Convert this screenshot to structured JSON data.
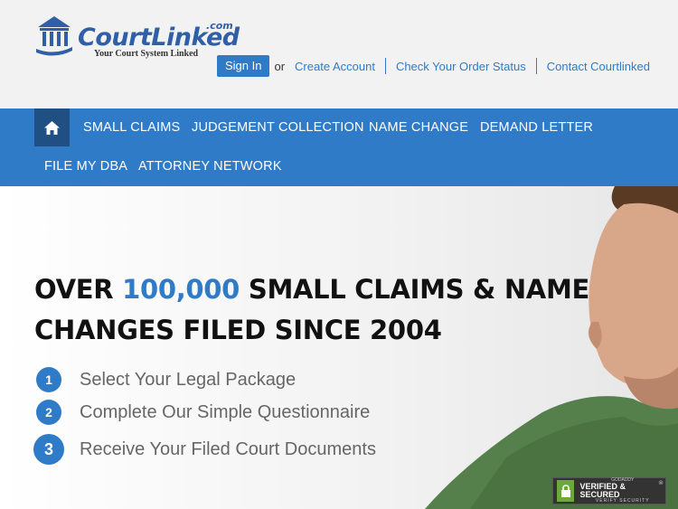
{
  "header": {
    "logo_name": "CourtLinked",
    "logo_com": ".com",
    "logo_tagline": "Your Court System Linked",
    "sign_in": "Sign In",
    "or": "or",
    "links": [
      "Create Account",
      "Check Your Order Status",
      "Contact Courtlinked"
    ]
  },
  "nav": {
    "home_icon": "home-icon",
    "items": [
      "SMALL CLAIMS",
      "JUDGEMENT COLLECTION",
      "NAME CHANGE",
      "DEMAND LETTER",
      "FILE MY DBA",
      "ATTORNEY NETWORK"
    ]
  },
  "hero": {
    "headline_part1": "OVER ",
    "headline_highlight": "100,000",
    "headline_part2": " SMALL CLAIMS & NAME CHANGES FILED SINCE 2004",
    "steps": [
      {
        "num": "1",
        "text": "Select Your Legal Package"
      },
      {
        "num": "2",
        "text": "Complete Our Simple Questionnaire"
      },
      {
        "num": "3",
        "text": "Receive Your Filed Court Documents"
      }
    ]
  },
  "badge": {
    "line1": "GODADDY",
    "line2": "VERIFIED & SECURED",
    "line3": "VERIFY SECURITY",
    "close": "⊗"
  },
  "colors": {
    "accent": "#2f7bc7",
    "nav_dark": "#1f4f83",
    "headline": "#111111",
    "step_text": "#666666"
  }
}
